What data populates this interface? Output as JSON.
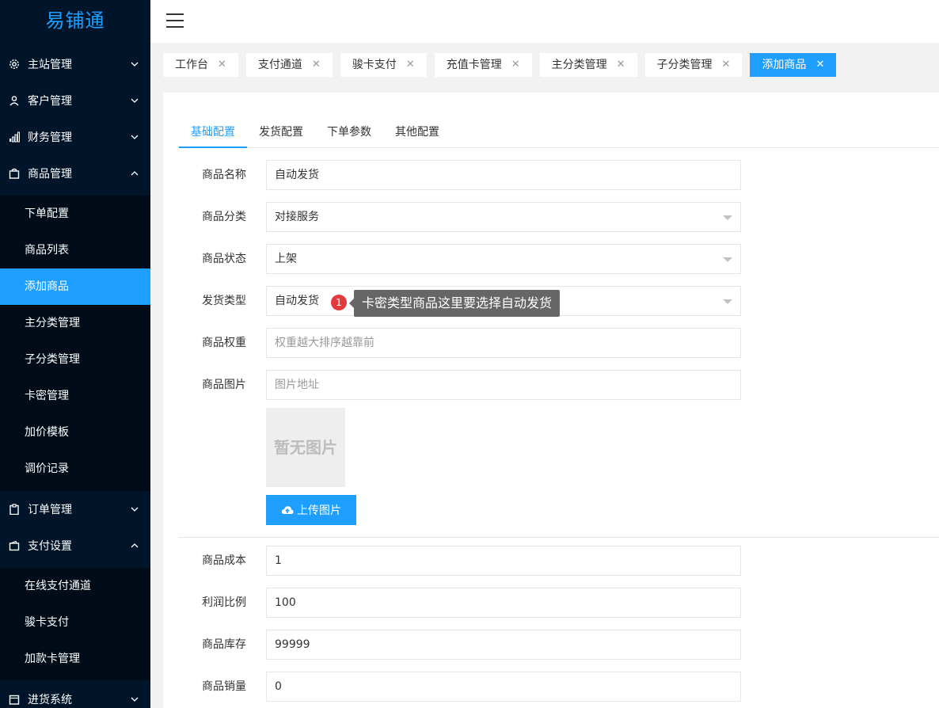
{
  "app": {
    "logo": "易铺通"
  },
  "sidebar": {
    "groups": [
      {
        "label": "主站管理",
        "icon": "gear-icon",
        "expanded": false
      },
      {
        "label": "客户管理",
        "icon": "user-icon",
        "expanded": false
      },
      {
        "label": "财务管理",
        "icon": "bar-chart-icon",
        "expanded": false
      },
      {
        "label": "商品管理",
        "icon": "bag-icon",
        "expanded": true,
        "items": [
          "下单配置",
          "商品列表",
          "添加商品",
          "主分类管理",
          "子分类管理",
          "卡密管理",
          "加价模板",
          "调价记录"
        ],
        "active": "添加商品"
      },
      {
        "label": "订单管理",
        "icon": "clipboard-icon",
        "expanded": false
      },
      {
        "label": "支付设置",
        "icon": "wallet-icon",
        "expanded": true,
        "items": [
          "在线支付通道",
          "骏卡支付",
          "加款卡管理"
        ]
      },
      {
        "label": "进货系统",
        "icon": "calendar-icon",
        "expanded": false
      }
    ]
  },
  "tabs": [
    {
      "label": "工作台",
      "active": false
    },
    {
      "label": "支付通道",
      "active": false
    },
    {
      "label": "骏卡支付",
      "active": false
    },
    {
      "label": "充值卡管理",
      "active": false
    },
    {
      "label": "主分类管理",
      "active": false
    },
    {
      "label": "子分类管理",
      "active": false
    },
    {
      "label": "添加商品",
      "active": true
    }
  ],
  "subtabs": [
    {
      "label": "基础配置",
      "active": true
    },
    {
      "label": "发货配置",
      "active": false
    },
    {
      "label": "下单参数",
      "active": false
    },
    {
      "label": "其他配置",
      "active": false
    }
  ],
  "form": {
    "name": {
      "label": "商品名称",
      "value": "自动发货"
    },
    "category": {
      "label": "商品分类",
      "value": "对接服务"
    },
    "status": {
      "label": "商品状态",
      "value": "上架"
    },
    "delivery_type": {
      "label": "发货类型",
      "value": "自动发货"
    },
    "weight": {
      "label": "商品权重",
      "placeholder": "权重越大排序越靠前"
    },
    "image": {
      "label": "商品图片",
      "placeholder": "图片地址",
      "no_image": "暂无图片",
      "upload_label": "上传图片"
    },
    "cost": {
      "label": "商品成本",
      "value": "1"
    },
    "profit": {
      "label": "利润比例",
      "value": "100"
    },
    "stock": {
      "label": "商品库存",
      "value": "99999"
    },
    "sales": {
      "label": "商品销量",
      "value": "0"
    }
  },
  "annotation": {
    "badge": "1",
    "text": "卡密类型商品这里要选择自动发货"
  },
  "colors": {
    "primary": "#1e9fff",
    "sidebar": "#001529",
    "submenu": "#000c17",
    "badge": "#e4393c"
  }
}
